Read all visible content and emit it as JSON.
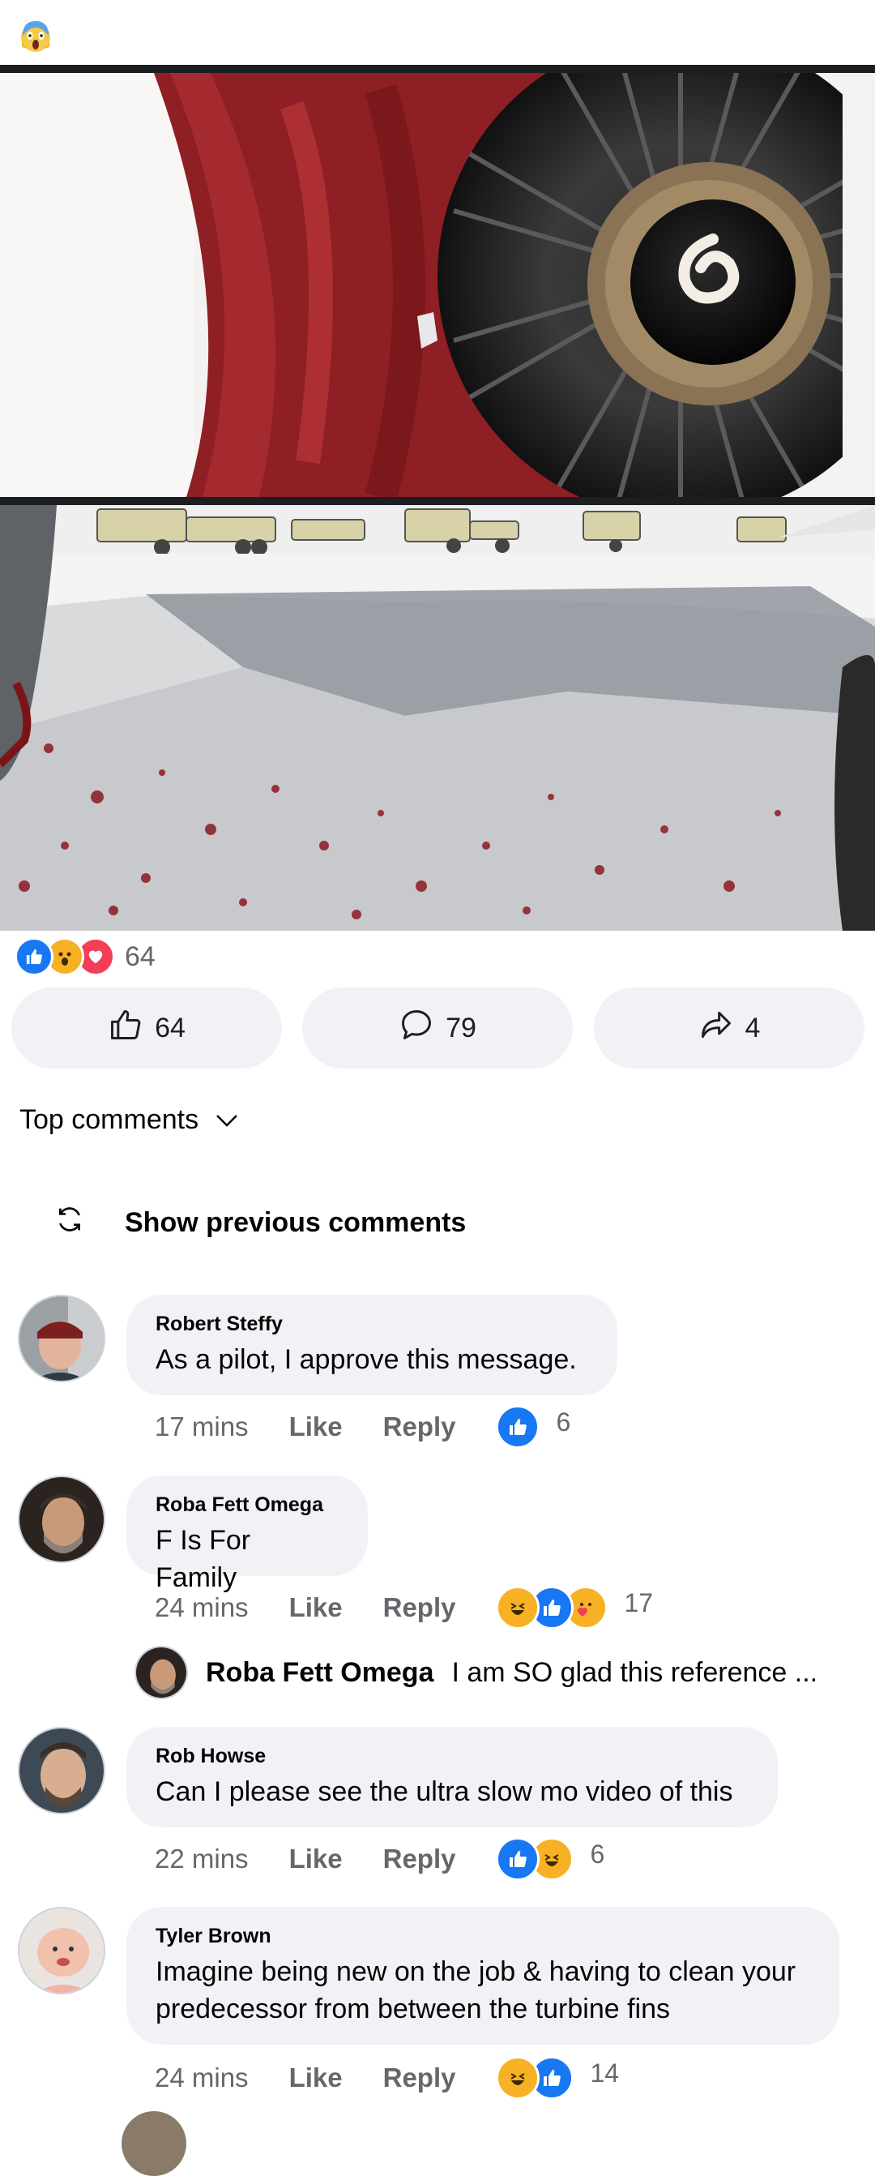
{
  "header": {
    "emoji_icon": "screaming-face-icon"
  },
  "post": {
    "reactions": {
      "icons": [
        "like",
        "wow",
        "love"
      ],
      "count": "64"
    },
    "actions": [
      {
        "icon": "thumbs-up-outline-icon",
        "count": "64"
      },
      {
        "icon": "comment-outline-icon",
        "count": "79"
      },
      {
        "icon": "share-outline-icon",
        "count": "4"
      }
    ]
  },
  "comments_section": {
    "sort_label": "Top comments",
    "previous_label": "Show previous comments",
    "like_label": "Like",
    "reply_label": "Reply",
    "comments": [
      {
        "author": "Robert Steffy",
        "text": "As a pilot, I approve this message.",
        "time": "17 mins",
        "reactions": [
          "like"
        ],
        "reaction_count": "6"
      },
      {
        "author": "Roba Fett Omega",
        "text": "F Is For Family",
        "time": "24 mins",
        "reactions": [
          "haha",
          "like",
          "care"
        ],
        "reaction_count": "17"
      },
      {
        "author": "Rob Howse",
        "text": "Can I please see the ultra slow mo video of this",
        "time": "22 mins",
        "reactions": [
          "like",
          "haha"
        ],
        "reaction_count": "6"
      },
      {
        "author": "Tyler Brown",
        "text_line1": "Imagine being new on the job & having to clean your",
        "text_line2": "predecessor from between the turbine fins",
        "time": "24 mins",
        "reactions": [
          "haha",
          "like"
        ],
        "reaction_count": "14"
      }
    ],
    "reply_preview": {
      "author": "Roba Fett Omega",
      "text": "I am SO glad this reference ..."
    }
  },
  "colors": {
    "like_blue": "#1877f2",
    "love_red": "#f33e58",
    "wow_yellow": "#f7b125",
    "bubble_gray": "#f0f2f5",
    "meta_gray": "#65676b"
  }
}
